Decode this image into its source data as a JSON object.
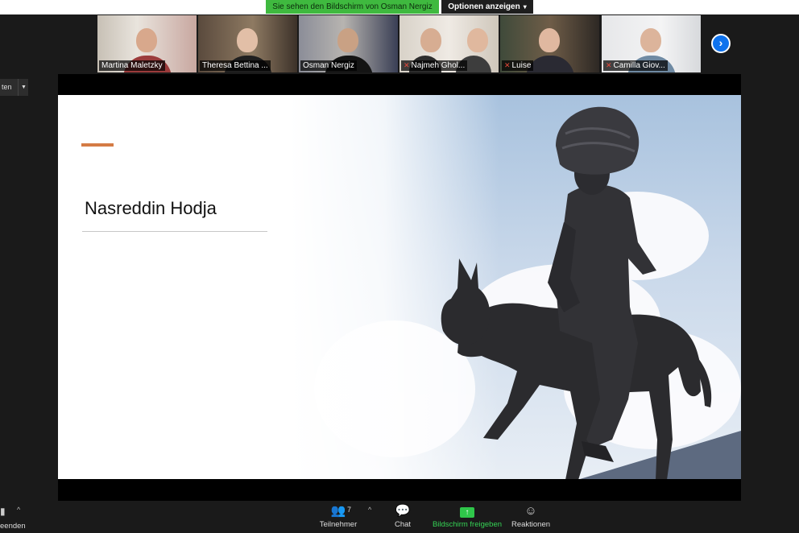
{
  "banner": {
    "share_text": "Sie sehen den Bildschirm von Osman Nergiz",
    "options_label": "Optionen anzeigen"
  },
  "participants": [
    {
      "name": "Martina Maletzky",
      "muted": false,
      "active": false
    },
    {
      "name": "Theresa Bettina ...",
      "muted": false,
      "active": false
    },
    {
      "name": "Osman Nergiz",
      "muted": false,
      "active": true
    },
    {
      "name": "Najmeh Ghol...",
      "muted": true,
      "active": false
    },
    {
      "name": "Luise",
      "muted": true,
      "active": false
    },
    {
      "name": "Camilla Giov...",
      "muted": true,
      "active": false
    }
  ],
  "side_stub": {
    "label": "ten"
  },
  "slide": {
    "title": "Nasreddin Hodja"
  },
  "toolbar": {
    "left_end_label": "eenden",
    "participants_label": "Teilnehmer",
    "participants_count": "7",
    "chat_label": "Chat",
    "share_label": "Bildschirm freigeben",
    "reactions_label": "Reaktionen"
  },
  "colors": {
    "accent": "#d47b45",
    "share_green": "#3fb93f",
    "next_blue": "#0e72ed",
    "active_outline": "#cfd84a"
  }
}
